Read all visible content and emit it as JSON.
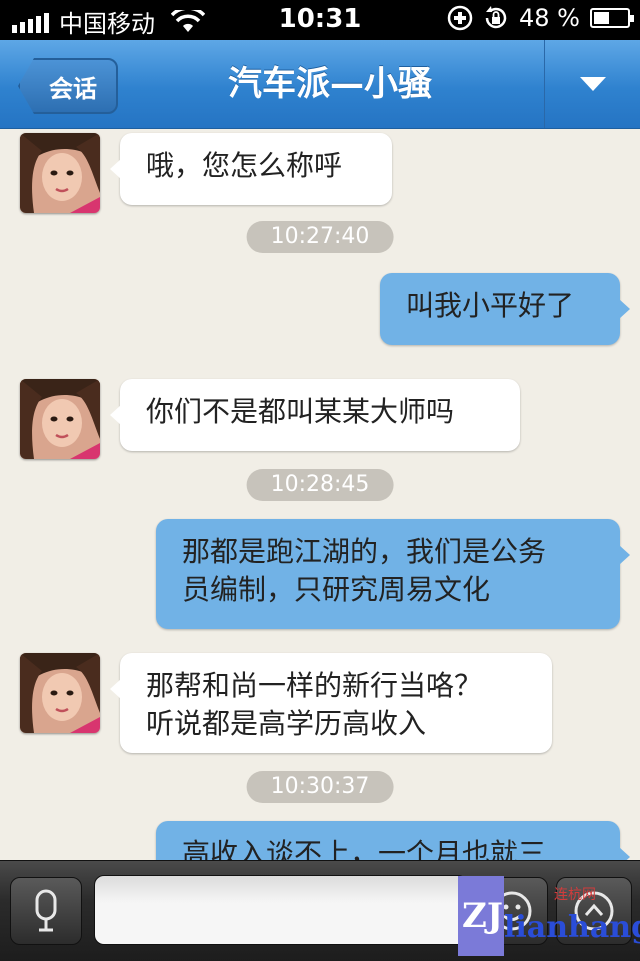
{
  "status_bar": {
    "carrier": "中国移动",
    "time": "10:31",
    "battery": "48 %",
    "battery_level": 0.48
  },
  "nav": {
    "back_label": "会话",
    "title": "汽车派—小骚",
    "menu_icon": "chevron-down-icon"
  },
  "messages": [
    {
      "side": "left",
      "text": "哦，您怎么称呼"
    },
    {
      "type": "timestamp",
      "text": "10:27:40"
    },
    {
      "side": "right",
      "text": "叫我小平好了"
    },
    {
      "side": "left",
      "text": "你们不是都叫某某大师吗"
    },
    {
      "type": "timestamp",
      "text": "10:28:45"
    },
    {
      "side": "right",
      "text": "那都是跑江湖的，我们是公务\n员编制，只研究周易文化"
    },
    {
      "side": "left",
      "text": "那帮和尚一样的新行当咯？\n听说都是高学历高收入"
    },
    {
      "type": "timestamp",
      "text": "10:30:37"
    },
    {
      "side": "right",
      "text": "高收入谈不上，一个月也就三"
    }
  ],
  "input_bar": {
    "value": "",
    "voice_icon": "microphone-icon",
    "emoji_icon": "emoji-icon",
    "more_icon": "plus-icon"
  },
  "watermark": {
    "logo_text": "ZJ",
    "brand_text": "lianhang",
    "small_text": "连杭网"
  },
  "colors": {
    "nav_blue": "#2f82cf",
    "bubble_sent": "#71b2e6",
    "bubble_received": "#ffffff",
    "timestamp_pill": "#c7c3bb"
  }
}
